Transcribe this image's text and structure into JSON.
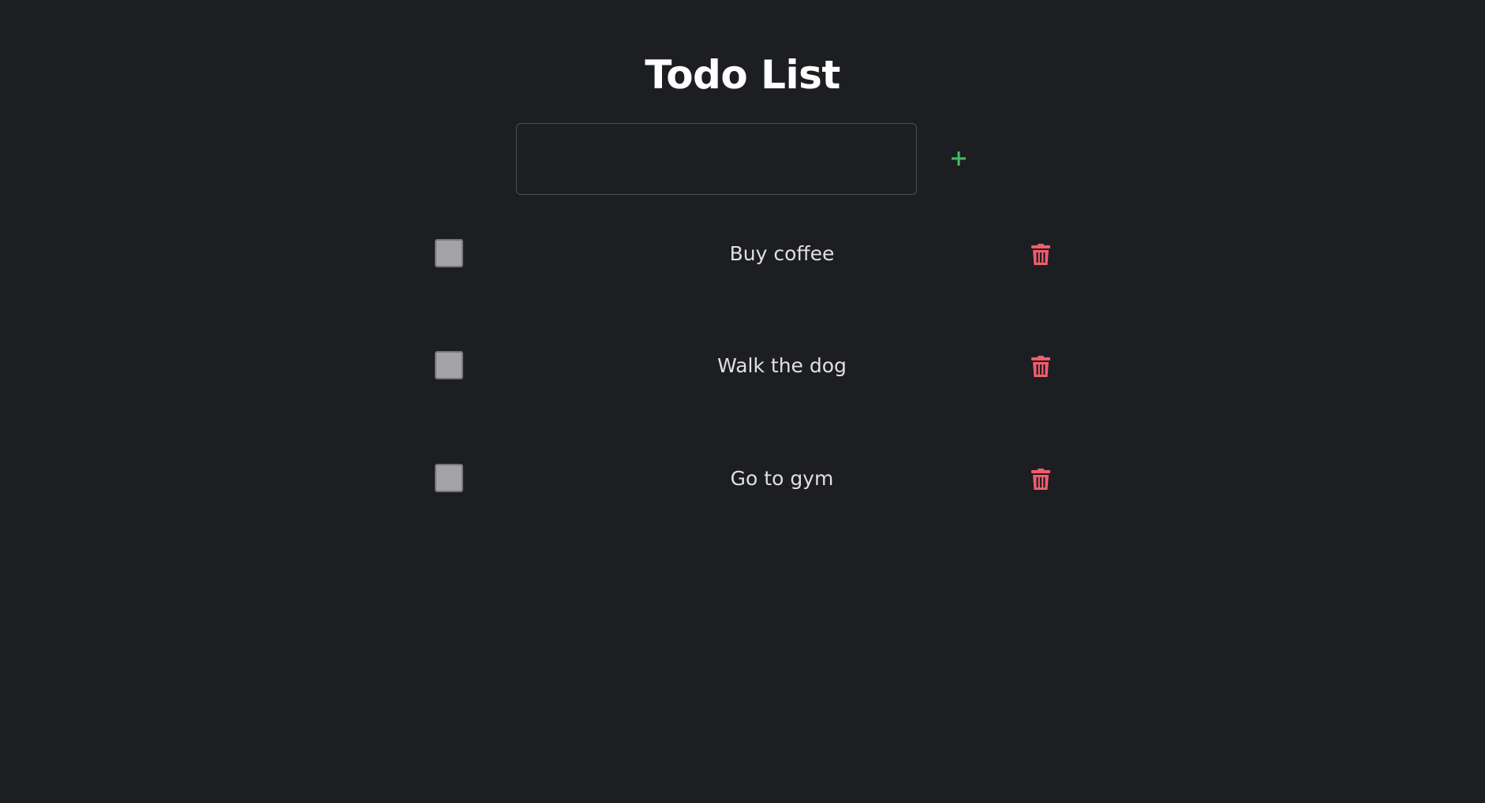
{
  "app": {
    "title": "Todo List"
  },
  "new_todo": {
    "value": "",
    "placeholder": "",
    "add_icon": "plus-icon"
  },
  "todos": [
    {
      "text": "Buy coffee",
      "checked": false,
      "delete_icon": "trash-icon"
    },
    {
      "text": "Walk the dog",
      "checked": false,
      "delete_icon": "trash-icon"
    },
    {
      "text": "Go to gym",
      "checked": false,
      "delete_icon": "trash-icon"
    }
  ],
  "colors": {
    "background": "#1d1e21",
    "title": "#ffffff",
    "text": "#e0e0e0",
    "add_accent": "#48bb6a",
    "delete_accent": "#f05d6c",
    "checkbox": "#a3a3a5"
  }
}
